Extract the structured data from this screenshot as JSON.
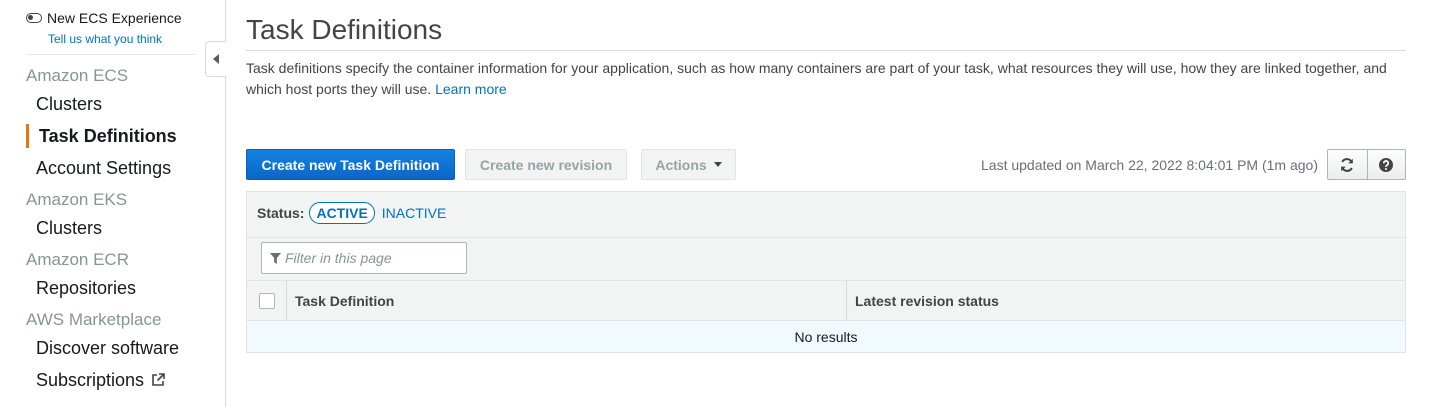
{
  "sidebar": {
    "toggle_label": "New ECS Experience",
    "feedback_link": "Tell us what you think",
    "sections": {
      "ecs": "Amazon ECS",
      "eks": "Amazon EKS",
      "ecr": "Amazon ECR",
      "marketplace": "AWS Marketplace"
    },
    "items": {
      "ecs_clusters": "Clusters",
      "task_definitions": "Task Definitions",
      "account_settings": "Account Settings",
      "eks_clusters": "Clusters",
      "repositories": "Repositories",
      "discover_software": "Discover software",
      "subscriptions": "Subscriptions"
    },
    "active_item": "Task Definitions"
  },
  "main": {
    "title": "Task Definitions",
    "description": "Task definitions specify the container information for your application, such as how many containers are part of your task, what resources they will use, how they are linked together, and which host ports they will use.",
    "learn_more": "Learn more",
    "buttons": {
      "create": "Create new Task Definition",
      "revision": "Create new revision",
      "actions": "Actions"
    },
    "last_updated": "Last updated on March 22, 2022 8:04:01 PM (1m ago)",
    "status": {
      "label": "Status:",
      "active": "ACTIVE",
      "inactive": "INACTIVE"
    },
    "filter": {
      "placeholder": "Filter in this page"
    },
    "table": {
      "columns": [
        "Task Definition",
        "Latest revision status"
      ],
      "empty_text": "No results"
    }
  },
  "colors": {
    "primary": "#0972d3",
    "link": "#0073bb",
    "active_nav_marker": "#ec7211",
    "section_text": "#879596",
    "empty_row_bg": "#f1fafe"
  }
}
